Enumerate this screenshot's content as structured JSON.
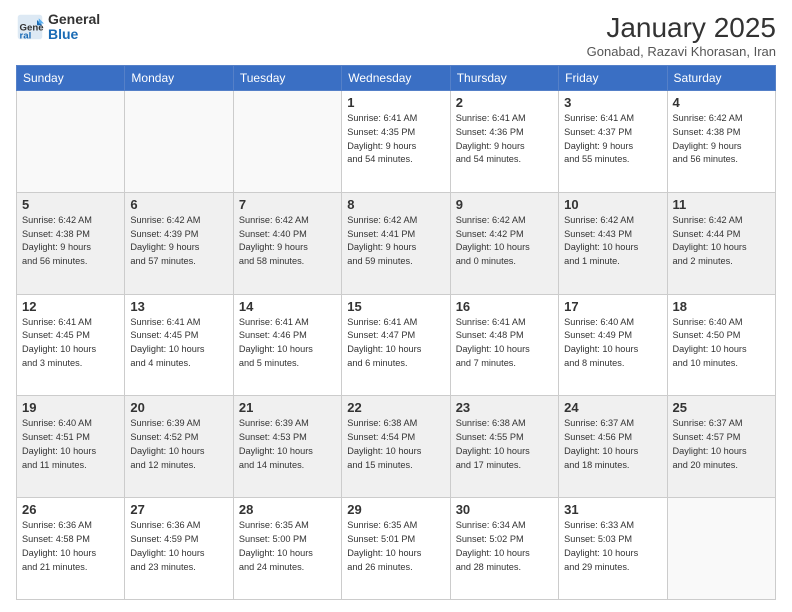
{
  "header": {
    "logo_general": "General",
    "logo_blue": "Blue",
    "month_title": "January 2025",
    "location": "Gonabad, Razavi Khorasan, Iran"
  },
  "days_of_week": [
    "Sunday",
    "Monday",
    "Tuesday",
    "Wednesday",
    "Thursday",
    "Friday",
    "Saturday"
  ],
  "weeks": [
    [
      {
        "day": "",
        "info": ""
      },
      {
        "day": "",
        "info": ""
      },
      {
        "day": "",
        "info": ""
      },
      {
        "day": "1",
        "info": "Sunrise: 6:41 AM\nSunset: 4:35 PM\nDaylight: 9 hours\nand 54 minutes."
      },
      {
        "day": "2",
        "info": "Sunrise: 6:41 AM\nSunset: 4:36 PM\nDaylight: 9 hours\nand 54 minutes."
      },
      {
        "day": "3",
        "info": "Sunrise: 6:41 AM\nSunset: 4:37 PM\nDaylight: 9 hours\nand 55 minutes."
      },
      {
        "day": "4",
        "info": "Sunrise: 6:42 AM\nSunset: 4:38 PM\nDaylight: 9 hours\nand 56 minutes."
      }
    ],
    [
      {
        "day": "5",
        "info": "Sunrise: 6:42 AM\nSunset: 4:38 PM\nDaylight: 9 hours\nand 56 minutes."
      },
      {
        "day": "6",
        "info": "Sunrise: 6:42 AM\nSunset: 4:39 PM\nDaylight: 9 hours\nand 57 minutes."
      },
      {
        "day": "7",
        "info": "Sunrise: 6:42 AM\nSunset: 4:40 PM\nDaylight: 9 hours\nand 58 minutes."
      },
      {
        "day": "8",
        "info": "Sunrise: 6:42 AM\nSunset: 4:41 PM\nDaylight: 9 hours\nand 59 minutes."
      },
      {
        "day": "9",
        "info": "Sunrise: 6:42 AM\nSunset: 4:42 PM\nDaylight: 10 hours\nand 0 minutes."
      },
      {
        "day": "10",
        "info": "Sunrise: 6:42 AM\nSunset: 4:43 PM\nDaylight: 10 hours\nand 1 minute."
      },
      {
        "day": "11",
        "info": "Sunrise: 6:42 AM\nSunset: 4:44 PM\nDaylight: 10 hours\nand 2 minutes."
      }
    ],
    [
      {
        "day": "12",
        "info": "Sunrise: 6:41 AM\nSunset: 4:45 PM\nDaylight: 10 hours\nand 3 minutes."
      },
      {
        "day": "13",
        "info": "Sunrise: 6:41 AM\nSunset: 4:45 PM\nDaylight: 10 hours\nand 4 minutes."
      },
      {
        "day": "14",
        "info": "Sunrise: 6:41 AM\nSunset: 4:46 PM\nDaylight: 10 hours\nand 5 minutes."
      },
      {
        "day": "15",
        "info": "Sunrise: 6:41 AM\nSunset: 4:47 PM\nDaylight: 10 hours\nand 6 minutes."
      },
      {
        "day": "16",
        "info": "Sunrise: 6:41 AM\nSunset: 4:48 PM\nDaylight: 10 hours\nand 7 minutes."
      },
      {
        "day": "17",
        "info": "Sunrise: 6:40 AM\nSunset: 4:49 PM\nDaylight: 10 hours\nand 8 minutes."
      },
      {
        "day": "18",
        "info": "Sunrise: 6:40 AM\nSunset: 4:50 PM\nDaylight: 10 hours\nand 10 minutes."
      }
    ],
    [
      {
        "day": "19",
        "info": "Sunrise: 6:40 AM\nSunset: 4:51 PM\nDaylight: 10 hours\nand 11 minutes."
      },
      {
        "day": "20",
        "info": "Sunrise: 6:39 AM\nSunset: 4:52 PM\nDaylight: 10 hours\nand 12 minutes."
      },
      {
        "day": "21",
        "info": "Sunrise: 6:39 AM\nSunset: 4:53 PM\nDaylight: 10 hours\nand 14 minutes."
      },
      {
        "day": "22",
        "info": "Sunrise: 6:38 AM\nSunset: 4:54 PM\nDaylight: 10 hours\nand 15 minutes."
      },
      {
        "day": "23",
        "info": "Sunrise: 6:38 AM\nSunset: 4:55 PM\nDaylight: 10 hours\nand 17 minutes."
      },
      {
        "day": "24",
        "info": "Sunrise: 6:37 AM\nSunset: 4:56 PM\nDaylight: 10 hours\nand 18 minutes."
      },
      {
        "day": "25",
        "info": "Sunrise: 6:37 AM\nSunset: 4:57 PM\nDaylight: 10 hours\nand 20 minutes."
      }
    ],
    [
      {
        "day": "26",
        "info": "Sunrise: 6:36 AM\nSunset: 4:58 PM\nDaylight: 10 hours\nand 21 minutes."
      },
      {
        "day": "27",
        "info": "Sunrise: 6:36 AM\nSunset: 4:59 PM\nDaylight: 10 hours\nand 23 minutes."
      },
      {
        "day": "28",
        "info": "Sunrise: 6:35 AM\nSunset: 5:00 PM\nDaylight: 10 hours\nand 24 minutes."
      },
      {
        "day": "29",
        "info": "Sunrise: 6:35 AM\nSunset: 5:01 PM\nDaylight: 10 hours\nand 26 minutes."
      },
      {
        "day": "30",
        "info": "Sunrise: 6:34 AM\nSunset: 5:02 PM\nDaylight: 10 hours\nand 28 minutes."
      },
      {
        "day": "31",
        "info": "Sunrise: 6:33 AM\nSunset: 5:03 PM\nDaylight: 10 hours\nand 29 minutes."
      },
      {
        "day": "",
        "info": ""
      }
    ]
  ]
}
